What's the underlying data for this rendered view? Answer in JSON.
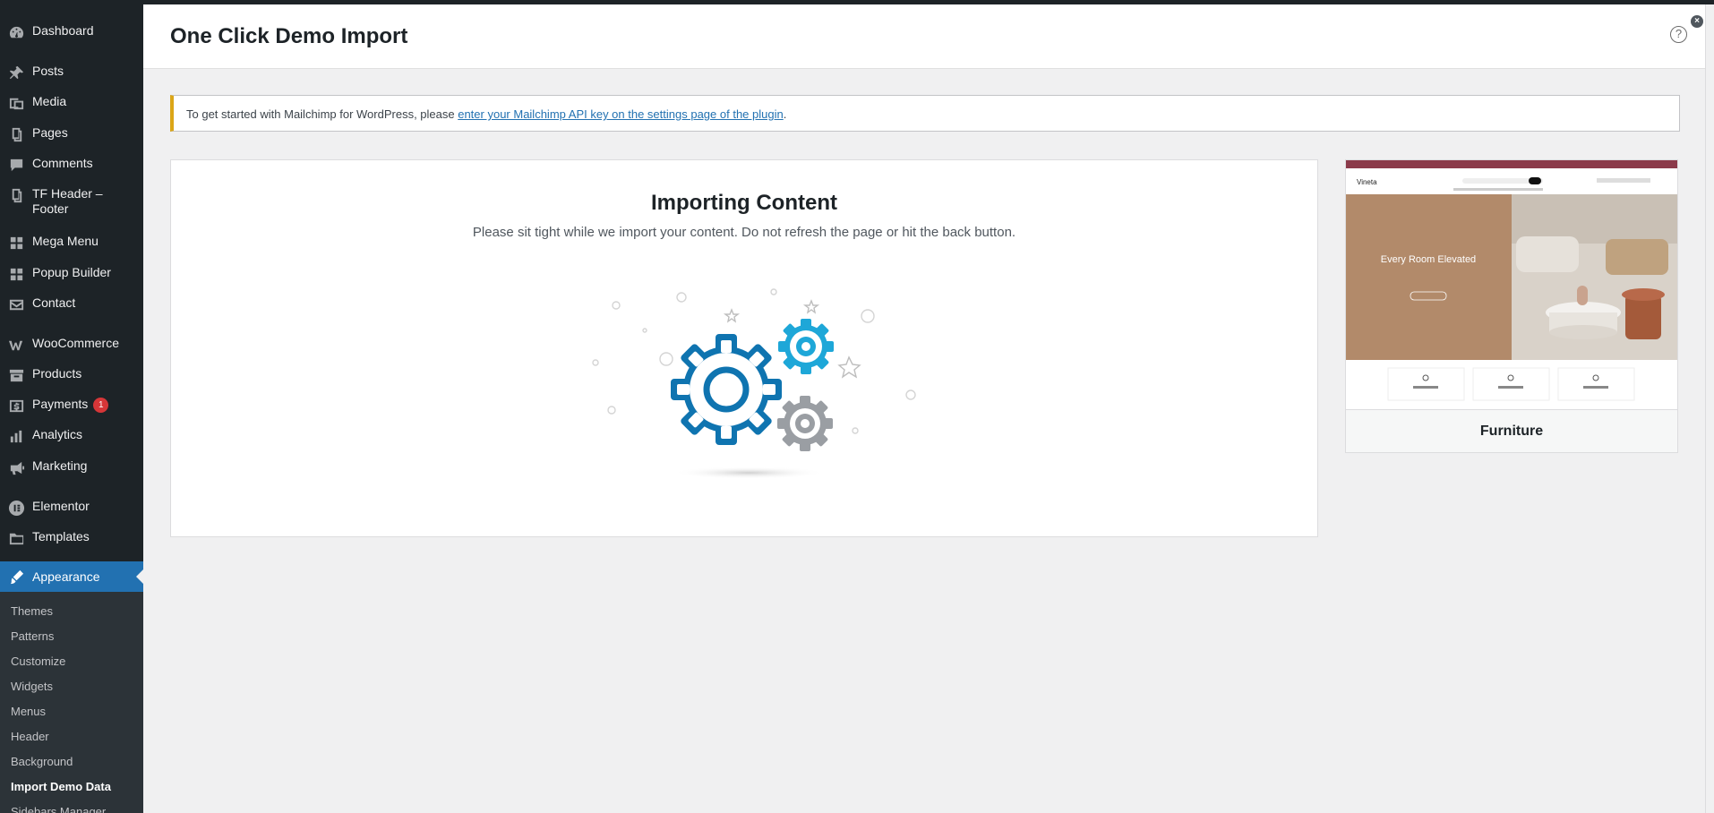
{
  "sidebar": {
    "items": [
      {
        "label": "Dashboard",
        "icon": "dashboard-icon"
      },
      {
        "label": "Posts",
        "icon": "pin-icon"
      },
      {
        "label": "Media",
        "icon": "media-icon"
      },
      {
        "label": "Pages",
        "icon": "pages-icon"
      },
      {
        "label": "Comments",
        "icon": "comments-icon"
      },
      {
        "label": "TF Header –",
        "label2": "Footer",
        "icon": "pages-icon"
      },
      {
        "label": "Mega Menu",
        "icon": "grid-icon"
      },
      {
        "label": "Popup Builder",
        "icon": "grid-icon"
      },
      {
        "label": "Contact",
        "icon": "mail-icon"
      },
      {
        "label": "WooCommerce",
        "icon": "woo-icon"
      },
      {
        "label": "Products",
        "icon": "archive-icon"
      },
      {
        "label": "Payments",
        "icon": "dollar-icon",
        "badge": "1"
      },
      {
        "label": "Analytics",
        "icon": "bar-chart-icon"
      },
      {
        "label": "Marketing",
        "icon": "megaphone-icon"
      },
      {
        "label": "Elementor",
        "icon": "elementor-icon"
      },
      {
        "label": "Templates",
        "icon": "folder-icon"
      },
      {
        "label": "Appearance",
        "icon": "brush-icon"
      }
    ],
    "submenu": [
      "Themes",
      "Patterns",
      "Customize",
      "Widgets",
      "Menus",
      "Header",
      "Background",
      "Import Demo Data",
      "Sidebars Manager"
    ]
  },
  "header": {
    "title": "One Click Demo Import",
    "help": "?",
    "close": "×"
  },
  "notice": {
    "text": "To get started with Mailchimp for WordPress, please ",
    "link": "enter your Mailchimp API key on the settings page of the plugin",
    "end": "."
  },
  "import": {
    "title": "Importing Content",
    "subtitle": "Please sit tight while we import your content. Do not refresh the page or hit the back button."
  },
  "demo": {
    "name": "Furniture",
    "preview": {
      "logo": "Vineta",
      "hero": "Every Room Elevated"
    }
  },
  "colors": {
    "sidebar_bg": "#1d2327",
    "active": "#2271b1",
    "notice_border": "#dba617",
    "gear_blue_dark": "#0f74b0",
    "gear_blue_light": "#1ea7d8",
    "gear_gray": "#9a9ea3",
    "hero_tan": "#b28a6a"
  }
}
